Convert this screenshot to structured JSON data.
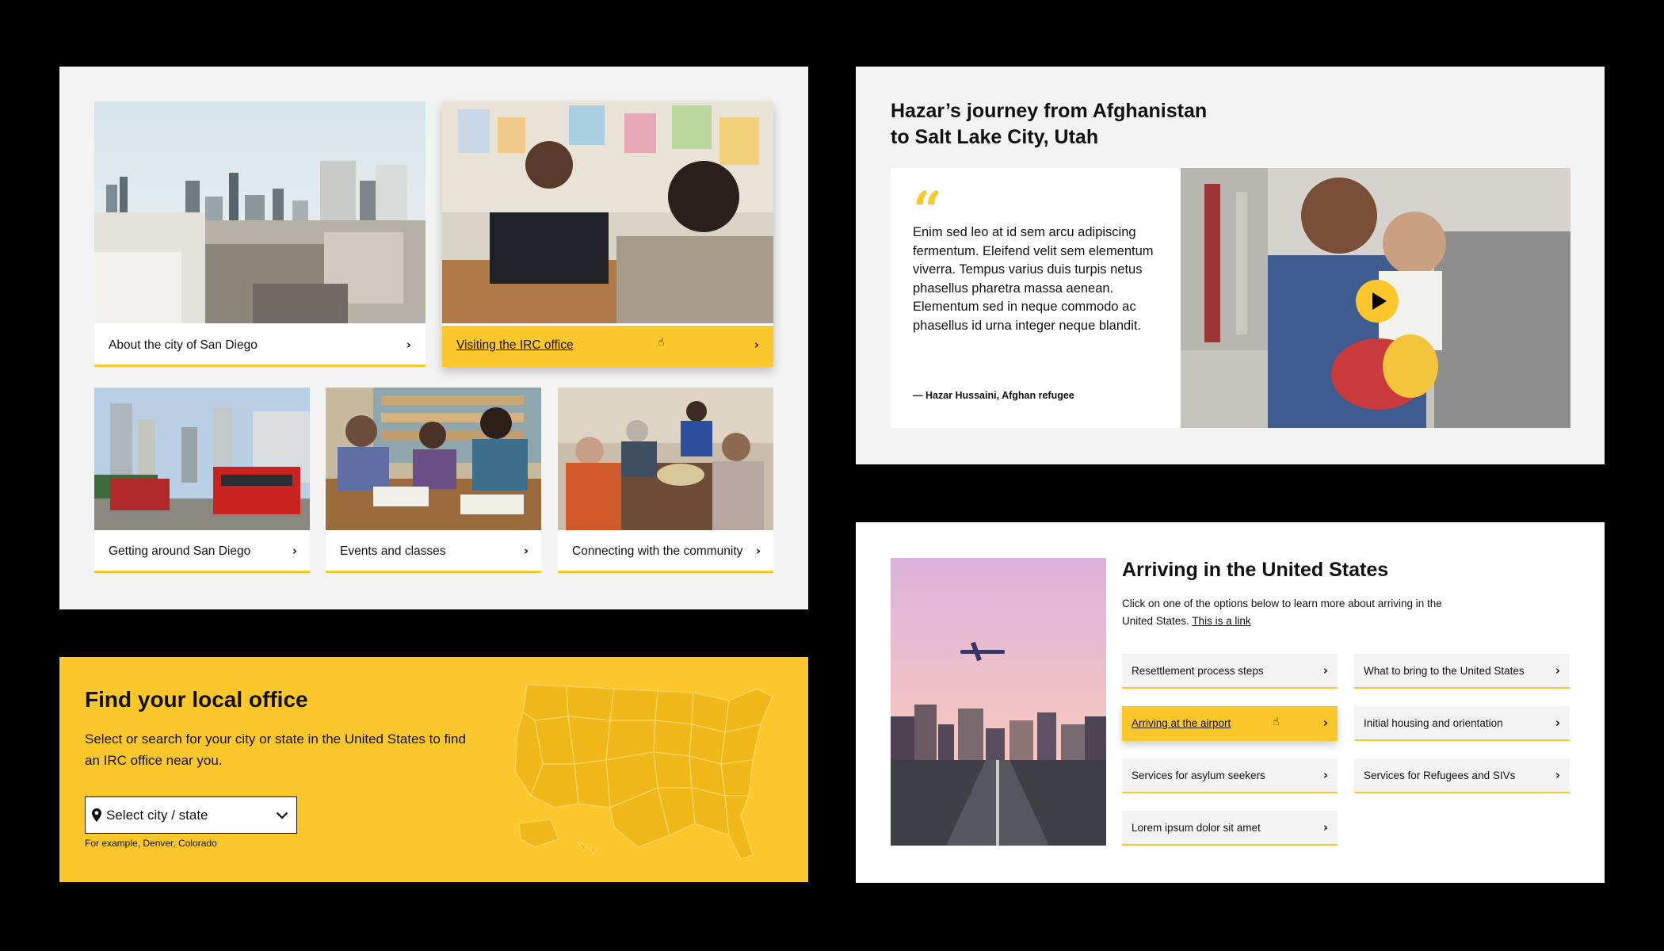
{
  "cards_panel": {
    "cards": [
      {
        "label": "About the city of San Diego",
        "image": "san-diego-skyline-photo"
      },
      {
        "label": "Visiting the IRC office",
        "image": "irc-office-meeting-photo"
      },
      {
        "label": "Getting around San Diego",
        "image": "trolley-photo"
      },
      {
        "label": "Events and classes",
        "image": "classroom-photo"
      },
      {
        "label": "Connecting with the community",
        "image": "community-meal-photo"
      }
    ],
    "chevron": "›",
    "accent": "#fcc72a"
  },
  "quote_panel": {
    "title_line1": "Hazar’s journey from Afghanistan",
    "title_line2": "to Salt Lake City, Utah",
    "quote_mark": "“",
    "quote": "Enim sed leo at id sem arcu adipiscing fermentum. Eleifend velit sem elementum viverra. Tempus varius duis turpis netus phasellus pharetra massa aenean. Elementum sed in neque commodo ac phasellus id urna integer neque blandit.",
    "attribution": "— Hazar Hussaini, Afghan refugee",
    "video_icon": "play-icon"
  },
  "office_panel": {
    "title": "Find your local office",
    "description": "Select or search for your city or state in the United States to find an IRC office near you.",
    "select_value": "Select city / state",
    "hint": "For example, Denver, Colorado",
    "map_image": "us-map-illustration"
  },
  "arrive_panel": {
    "title": "Arriving in the United States",
    "description": "Click on one of the options below to learn more about arriving in the United States.",
    "link": "This is a link",
    "options": [
      {
        "label": "Resettlement process steps"
      },
      {
        "label": "What to bring to the United States"
      },
      {
        "label": "Arriving at the airport"
      },
      {
        "label": "Initial housing and orientation"
      },
      {
        "label": "Services for asylum seekers"
      },
      {
        "label": "Services for Refugees and SIVs"
      },
      {
        "label": "Lorem ipsum dolor sit amet"
      }
    ],
    "photo": "airplane-over-city-photo"
  }
}
